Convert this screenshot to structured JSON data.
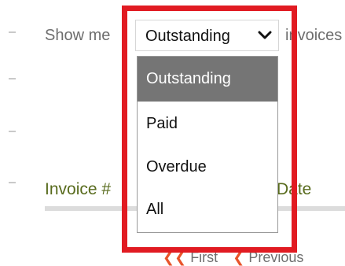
{
  "filter": {
    "prefix": "Show me",
    "suffix": "invoices",
    "selected_value": "Outstanding",
    "options": [
      "Outstanding",
      "Paid",
      "Overdue",
      "All"
    ]
  },
  "table": {
    "columns": [
      "Invoice #",
      "Date"
    ]
  },
  "pagination": {
    "first_label": "First",
    "previous_label": "Previous"
  }
}
